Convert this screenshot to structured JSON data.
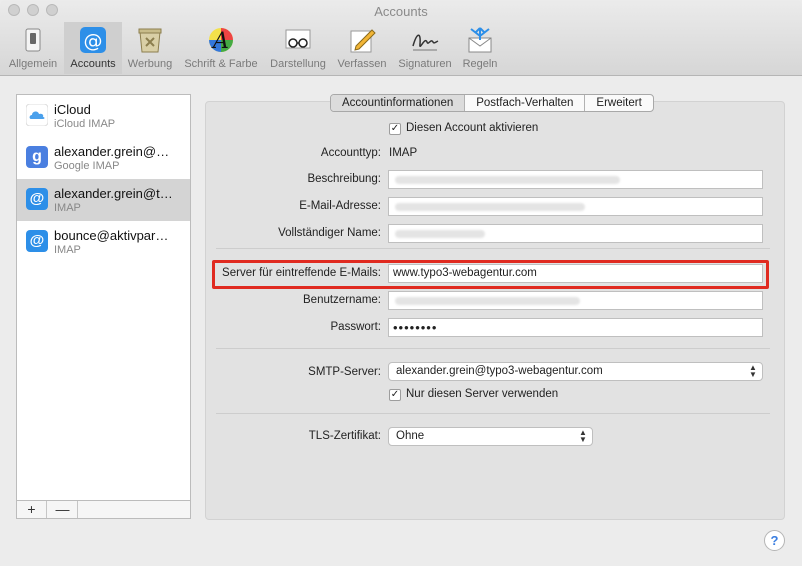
{
  "window": {
    "title": "Accounts"
  },
  "toolbar": {
    "items": [
      {
        "label": "Allgemein",
        "icon": "switch-icon"
      },
      {
        "label": "Accounts",
        "icon": "at-icon",
        "active": true
      },
      {
        "label": "Werbung",
        "icon": "trash-icon"
      },
      {
        "label": "Schrift & Farbe",
        "icon": "font-color-icon"
      },
      {
        "label": "Darstellung",
        "icon": "glasses-icon"
      },
      {
        "label": "Verfassen",
        "icon": "pencil-icon"
      },
      {
        "label": "Signaturen",
        "icon": "signature-icon"
      },
      {
        "label": "Regeln",
        "icon": "rules-icon"
      }
    ]
  },
  "accounts": [
    {
      "name": "iCloud",
      "type": "iCloud IMAP",
      "icon": "cloud-icon"
    },
    {
      "name": "alexander.grein@…",
      "type": "Google IMAP",
      "icon": "google-icon"
    },
    {
      "name": "alexander.grein@t…",
      "type": "IMAP",
      "icon": "at-icon",
      "selected": true
    },
    {
      "name": "bounce@aktivpar…",
      "type": "IMAP",
      "icon": "at-icon"
    }
  ],
  "list_buttons": {
    "add": "+",
    "remove": "—"
  },
  "tabs": [
    "Accountinformationen",
    "Postfach-Verhalten",
    "Erweitert"
  ],
  "form": {
    "enable_label": "Diesen Account aktivieren",
    "account_type_label": "Accounttyp:",
    "account_type_value": "IMAP",
    "description_label": "Beschreibung:",
    "email_label": "E-Mail-Adresse:",
    "fullname_label": "Vollständiger Name:",
    "incoming_server_label": "Server für eintreffende E-Mails:",
    "incoming_server_value": "www.typo3-webagentur.com",
    "username_label": "Benutzername:",
    "password_label": "Passwort:",
    "password_value": "••••••••",
    "smtp_label": "SMTP-Server:",
    "smtp_value": "alexander.grein@typo3-webagentur.com",
    "only_this_server_label": "Nur diesen Server verwenden",
    "tls_label": "TLS-Zertifikat:",
    "tls_value": "Ohne"
  },
  "help": "?",
  "colors": {
    "accent_blue": "#2d8fe8",
    "highlight_red": "#e02a20"
  }
}
